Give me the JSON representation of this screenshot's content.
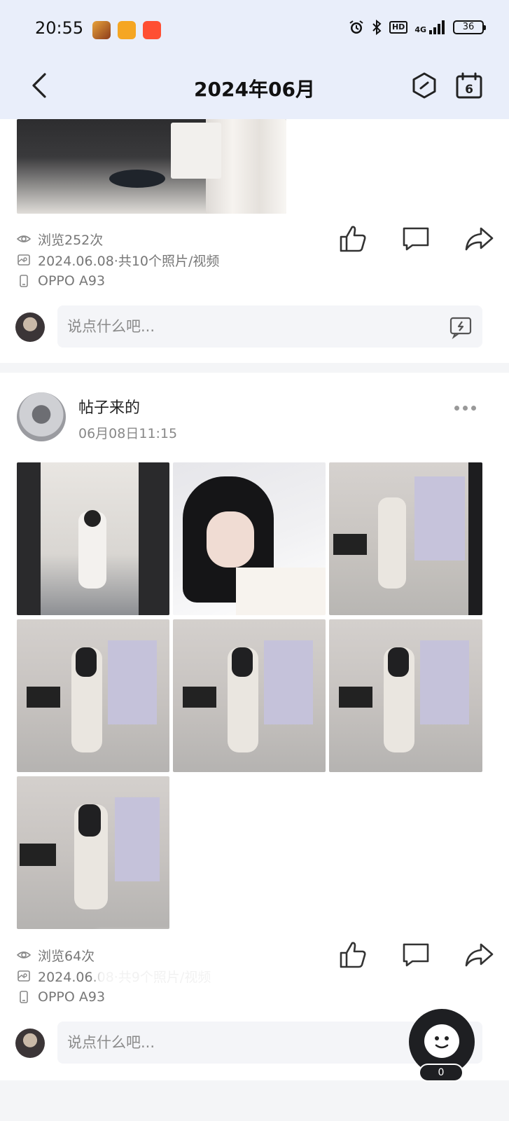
{
  "status_bar": {
    "time": "20:55",
    "network": "4G",
    "hd_label": "HD",
    "battery": "36"
  },
  "header": {
    "title": "2024年06月",
    "calendar_day": "6"
  },
  "posts": [
    {
      "views": "浏览252次",
      "date_info": "2024.06.08·共10个照片/视频",
      "device": "OPPO  A93",
      "comment_placeholder": "说点什么吧..."
    },
    {
      "author": "帖子来的",
      "timestamp": "06月08日11:15",
      "views": "浏览64次",
      "date_info": "2024.06.08·共9个照片/视频",
      "device": "OPPO  A93",
      "comment_placeholder": "说点什么吧..."
    }
  ],
  "floating_assistant": {
    "badge_count": "0"
  },
  "colors": {
    "header_bg": "#e9eefa",
    "page_bg": "#f4f5f7",
    "icon_stroke": "#333333",
    "meta_text": "#777777"
  }
}
